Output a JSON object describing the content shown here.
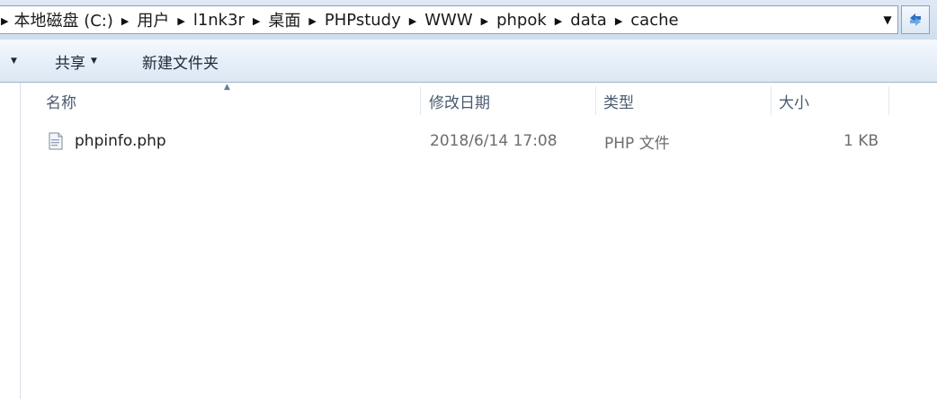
{
  "address_bar": {
    "crumbs": [
      "本地磁盘 (C:)",
      "用户",
      "l1nk3r",
      "桌面",
      "PHPstudy",
      "WWW",
      "phpok",
      "data",
      "cache"
    ]
  },
  "toolbar": {
    "share_label": "共享",
    "new_folder_label": "新建文件夹"
  },
  "columns": {
    "name": "名称",
    "modified": "修改日期",
    "type": "类型",
    "size": "大小"
  },
  "files": [
    {
      "name": "phpinfo.php",
      "modified": "2018/6/14 17:08",
      "type": "PHP 文件",
      "size": "1 KB",
      "icon": "php-file-icon"
    }
  ],
  "colors": {
    "toolbar_text": "#1c2a3c",
    "header_text": "#4b5b6e",
    "meta_text": "#6d6d6d",
    "divider": "#d6e0ec"
  }
}
